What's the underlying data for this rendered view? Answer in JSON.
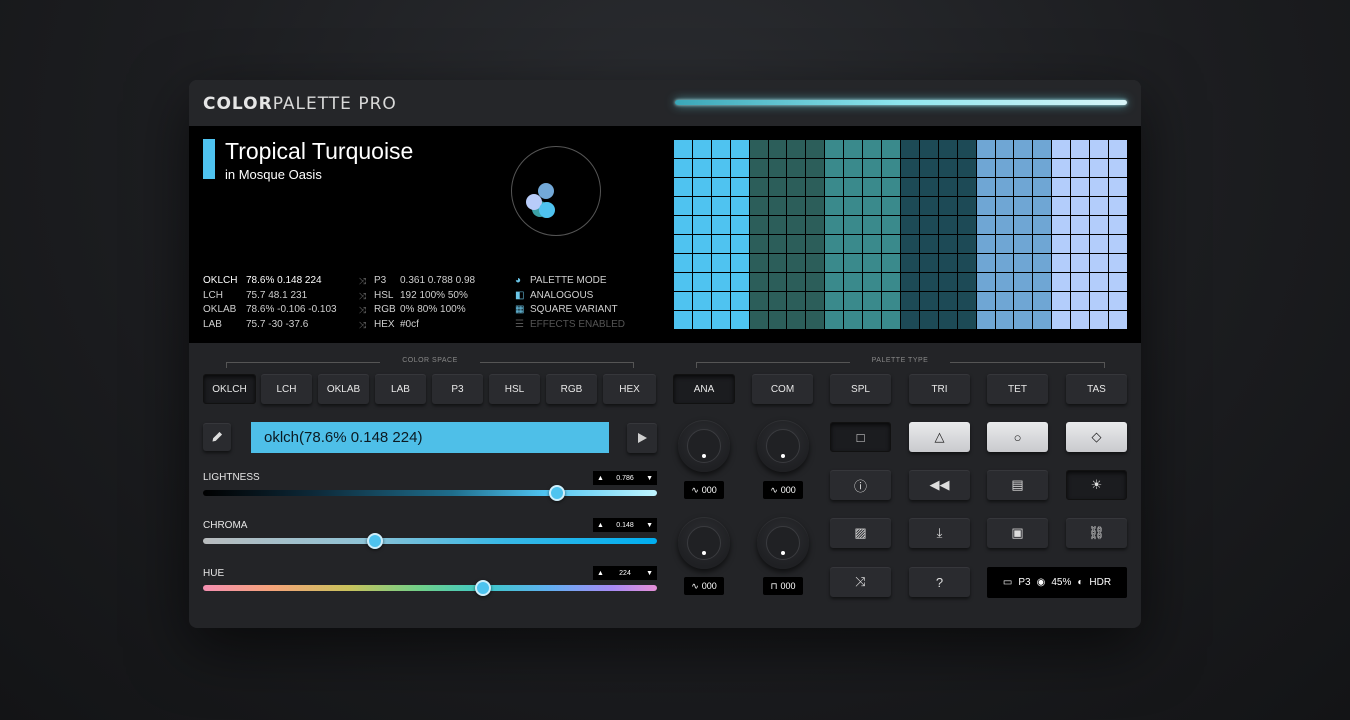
{
  "app": {
    "logo_bold": "COLOR",
    "logo_light": "PALETTE PRO"
  },
  "color": {
    "name": "Tropical Turquoise",
    "subtitle": "in Mosque Oasis",
    "swatch": "#4fc3f0"
  },
  "readouts": {
    "left": [
      {
        "key": "OKLCH",
        "value": "78.6% 0.148 224",
        "active": true
      },
      {
        "key": "LCH",
        "value": "75.7 48.1 231"
      },
      {
        "key": "OKLAB",
        "value": "78.6% -0.106 -0.103"
      },
      {
        "key": "LAB",
        "value": "75.7 -30 -37.6"
      }
    ],
    "right": [
      {
        "key": "P3",
        "value": "0.361 0.788 0.98"
      },
      {
        "key": "HSL",
        "value": "192 100% 50%"
      },
      {
        "key": "RGB",
        "value": "0% 80% 100%"
      },
      {
        "key": "HEX",
        "value": "#0cf"
      }
    ]
  },
  "modes": [
    {
      "icon": "palette-icon",
      "label": "PALETTE MODE"
    },
    {
      "icon": "analogous-icon",
      "label": "ANALOGOUS"
    },
    {
      "icon": "grid-icon",
      "label": "SQUARE VARIANT"
    },
    {
      "icon": "sliders-icon",
      "label": "EFFECTS ENABLED",
      "dim": true
    }
  ],
  "palette_columns": [
    "#4fc3f0",
    "#4fc3f0",
    "#4fc3f0",
    "#4fc3f0",
    "#2c5e5a",
    "#2c5e5a",
    "#2c5e5a",
    "#2c5e5a",
    "#3a8a8c",
    "#3a8a8c",
    "#3a8a8c",
    "#3a8a8c",
    "#1d4a56",
    "#1d4a56",
    "#1d4a56",
    "#1d4a56",
    "#6fa6d4",
    "#6fa6d4",
    "#6fa6d4",
    "#6fa6d4",
    "#b3cdfb",
    "#b3cdfb",
    "#b3cdfb",
    "#b3cdfb"
  ],
  "color_space": {
    "label": "COLOR SPACE",
    "buttons": [
      "OKLCH",
      "LCH",
      "OKLAB",
      "LAB",
      "P3",
      "HSL",
      "RGB",
      "HEX"
    ],
    "selected": "OKLCH"
  },
  "palette_type": {
    "label": "PALETTE TYPE",
    "buttons": [
      "ANA",
      "COM",
      "SPL",
      "TRI",
      "TET",
      "TAS"
    ],
    "selected": "ANA"
  },
  "value_field": "oklch(78.6% 0.148 224)",
  "sliders": [
    {
      "label": "LIGHTNESS",
      "value": "0.786",
      "fraction": 0.786
    },
    {
      "label": "CHROMA",
      "value": "0.148",
      "fraction": 0.38
    },
    {
      "label": "HUE",
      "value": "224",
      "fraction": 0.62
    }
  ],
  "knobs": [
    {
      "wave": "triangle-wave-icon",
      "value": "000"
    },
    {
      "wave": "sine-wave-icon",
      "value": "000"
    },
    {
      "wave": "triangle-wave-icon",
      "value": "000"
    },
    {
      "wave": "square-wave-icon",
      "value": "000"
    }
  ],
  "status": {
    "gamut": "P3",
    "vision": "45%",
    "mode": "HDR"
  }
}
